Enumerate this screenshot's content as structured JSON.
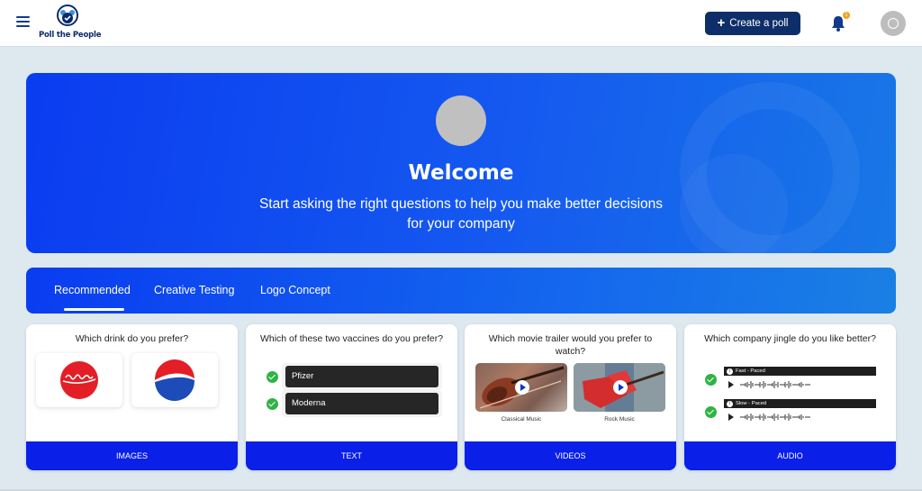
{
  "app": {
    "name": "Poll the People"
  },
  "header": {
    "create_poll_label": "Create a poll",
    "notification_count": "1",
    "icons": {
      "menu": "hamburger-menu-icon",
      "bell": "bell-icon",
      "avatar": "user-avatar"
    }
  },
  "hero": {
    "title": "Welcome",
    "subtitle": "Start asking the right questions to help you make better decisions for your company"
  },
  "tabs": [
    {
      "label": "Recommended",
      "active": true
    },
    {
      "label": "Creative Testing",
      "active": false
    },
    {
      "label": "Logo Concept",
      "active": false
    }
  ],
  "cards": [
    {
      "question": "Which drink do you prefer?",
      "type_label": "IMAGES",
      "options": [
        "Coca-Cola",
        "Pepsi"
      ]
    },
    {
      "question": "Which of these two vaccines do you prefer?",
      "type_label": "TEXT",
      "options": [
        "Pfizer",
        "Moderna"
      ]
    },
    {
      "question": "Which movie trailer would you prefer to watch?",
      "type_label": "VIDEOS",
      "options": [
        "Classical Music",
        "Rock Music"
      ]
    },
    {
      "question": "Which company jingle do you like better?",
      "type_label": "AUDIO",
      "options": [
        "Fast - Paced",
        "Slow - Paced"
      ]
    }
  ],
  "colors": {
    "brand_dark": "#0d2e68",
    "hero_blue": "#0a3cf0",
    "card_footer": "#0a1fe8",
    "check_green": "#2fb345",
    "notification": "#f2a31b"
  }
}
